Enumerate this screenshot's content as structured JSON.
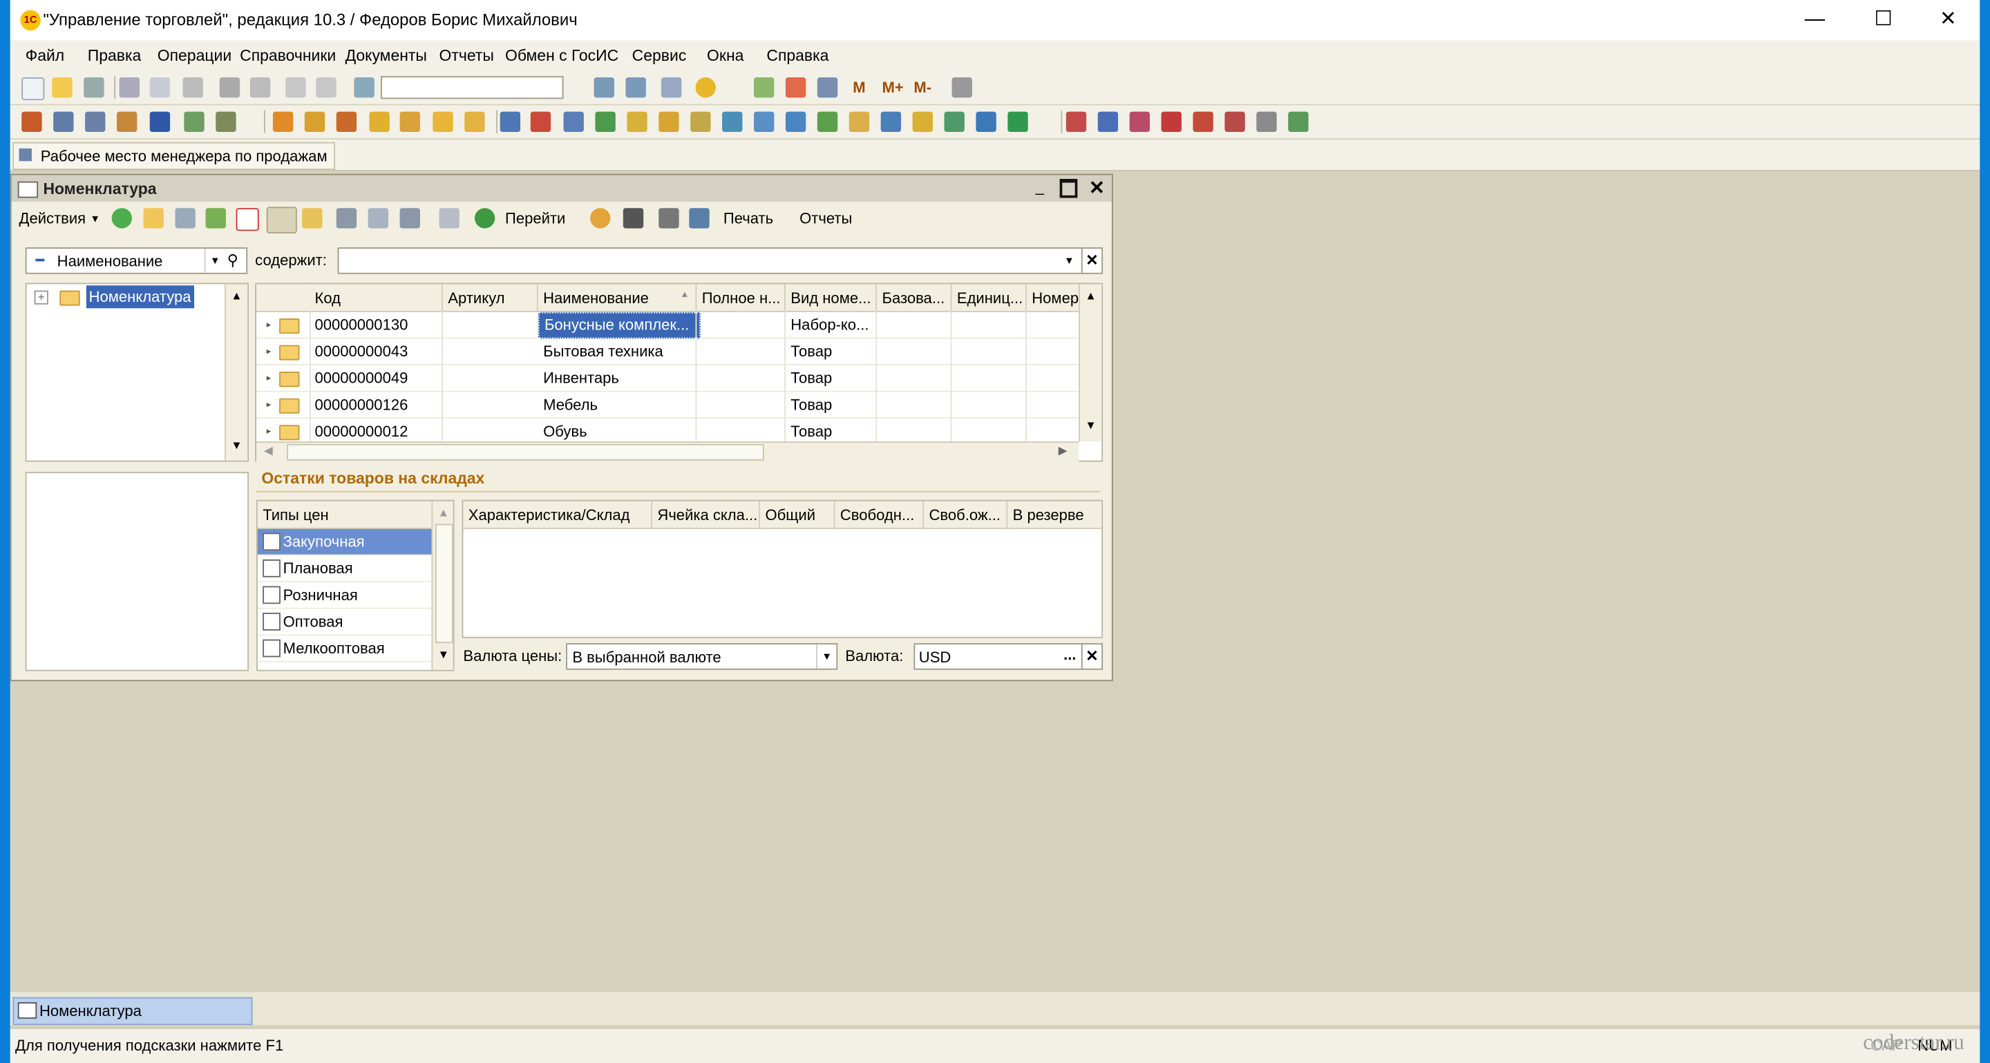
{
  "titlebar": {
    "title": "\"Управление торговлей\", редакция 10.3 / Федоров Борис Михайлович",
    "logo": "1С",
    "minimize": "—",
    "maximize": "☐",
    "close": "✕"
  },
  "menu": [
    "Файл",
    "Правка",
    "Операции",
    "Справочники",
    "Документы",
    "Отчеты",
    "Обмен с ГосИС",
    "Сервис",
    "Окна",
    "Справка"
  ],
  "toolbar": {
    "mem1": "M",
    "mem2": "M+",
    "mem3": "M-"
  },
  "panel": {
    "label": "Рабочее место менеджера по продажам"
  },
  "child": {
    "title": "Номенклатура",
    "actions": "Действия",
    "goto": "Перейти",
    "print": "Печать",
    "reports": "Отчеты",
    "filter_field": "Наименование",
    "contains_label": "содержит:",
    "contains_value": "",
    "tree_root": "Номенклатура",
    "columns": [
      "Код",
      "Артикул",
      "Наименование",
      "Полное н...",
      "Вид номе...",
      "Базова...",
      "Единиц...",
      "Номер"
    ],
    "rows": [
      {
        "code": "00000000130",
        "article": "",
        "name": "Бонусные комплек...",
        "full": "",
        "kind": "Набор-ко..."
      },
      {
        "code": "00000000043",
        "article": "",
        "name": "Бытовая техника",
        "full": "",
        "kind": "Товар"
      },
      {
        "code": "00000000049",
        "article": "",
        "name": "Инвентарь",
        "full": "",
        "kind": "Товар"
      },
      {
        "code": "00000000126",
        "article": "",
        "name": "Мебель",
        "full": "",
        "kind": "Товар"
      },
      {
        "code": "00000000012",
        "article": "",
        "name": "Обувь",
        "full": "",
        "kind": "Товар"
      }
    ],
    "stock_section": "Остатки товаров на складах",
    "price_types_header": "Типы цен",
    "price_types": [
      "Закупочная",
      "Плановая",
      "Розничная",
      "Оптовая",
      "Мелкооптовая"
    ],
    "stock_columns": [
      "Характеристика/Склад",
      "Ячейка скла...",
      "Общий",
      "Свободн...",
      "Своб.ож...",
      "В резерве"
    ],
    "currency_label": "Валюта цены:",
    "currency_mode": "В выбранной валюте",
    "currency2_label": "Валюта:",
    "currency2_value": "USD",
    "dots": "..."
  },
  "taskbar": {
    "item": "Номенклатура"
  },
  "status": {
    "hint": "Для получения подсказки нажмите F1",
    "cap": "CAP",
    "num": "NUM"
  },
  "watermark": "coderstar.ru"
}
